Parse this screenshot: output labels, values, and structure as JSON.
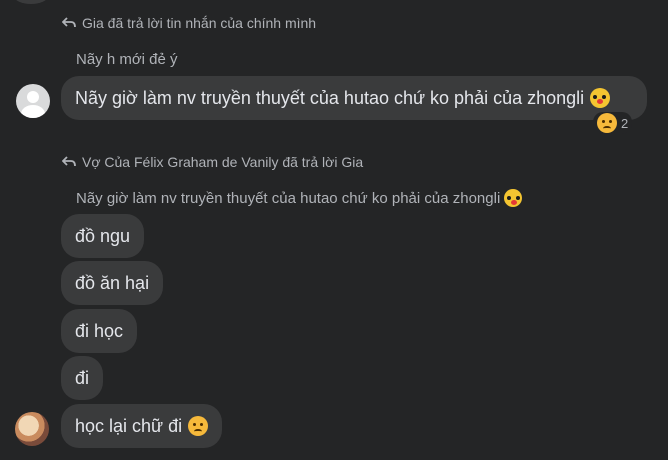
{
  "first_thread": {
    "reply_header": "Gia đã trả lời tin nhắn của chính mình",
    "quoted_text": "Nãy h mới đẻ ý",
    "message": "Nãy giờ làm nv truyền thuyết của hutao chứ ko phải của zhongli",
    "message_emoji": "clown-face-emoji",
    "reaction": {
      "emoji": "sad-face-emoji",
      "count": "2"
    }
  },
  "second_thread": {
    "reply_header": "Vợ Của Félix Graham de Vanily đã trả lời Gia",
    "quoted_text": "Nãy giờ làm nv truyền thuyết của hutao chứ ko phải của zhongli",
    "quoted_emoji": "clown-face-emoji",
    "messages": [
      {
        "text": "đồ ngu"
      },
      {
        "text": "đồ ăn hại"
      },
      {
        "text": "đi học"
      },
      {
        "text": "đi"
      },
      {
        "text": "học lại chữ đi",
        "emoji": "frowning-face-emoji"
      }
    ]
  },
  "colors": {
    "background": "#242526",
    "bubble": "#3a3b3c",
    "text": "#e4e6eb",
    "muted": "#b0b3b8"
  }
}
